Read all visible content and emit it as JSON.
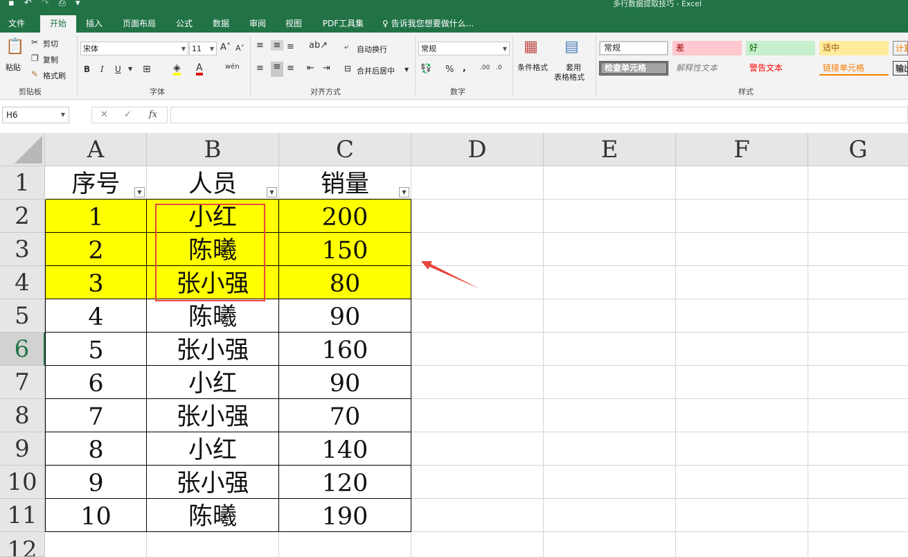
{
  "window": {
    "title": "多行数据提取技巧 - Excel"
  },
  "tabs": [
    {
      "label": "文件",
      "active": false
    },
    {
      "label": "开始",
      "active": true
    },
    {
      "label": "插入",
      "active": false
    },
    {
      "label": "页面布局",
      "active": false
    },
    {
      "label": "公式",
      "active": false
    },
    {
      "label": "数据",
      "active": false
    },
    {
      "label": "审阅",
      "active": false
    },
    {
      "label": "视图",
      "active": false
    },
    {
      "label": "PDF工具集",
      "active": false
    },
    {
      "label": "告诉我您想要做什么...",
      "active": false
    }
  ],
  "ribbon": {
    "clipboard": {
      "paste": "粘贴",
      "cut": "剪切",
      "copy": "复制",
      "format_painter": "格式刷",
      "group": "剪贴板"
    },
    "font": {
      "name": "宋体",
      "size": "11",
      "group": "字体",
      "bold": "B",
      "italic": "I",
      "underline": "U",
      "phonetic": "wén"
    },
    "alignment": {
      "wrap": "自动换行",
      "merge": "合并后居中",
      "group": "对齐方式"
    },
    "number": {
      "format": "常规",
      "group": "数字",
      "percent": "%",
      "comma": ","
    },
    "styles": {
      "conditional": "条件格式",
      "table_format_1": "套用",
      "table_format_2": "表格格式",
      "group": "样式",
      "cells": [
        {
          "label": "常规",
          "bg": "#ffffff",
          "color": "#000000"
        },
        {
          "label": "差",
          "bg": "#ffc7ce",
          "color": "#9c0006"
        },
        {
          "label": "好",
          "bg": "#c6efce",
          "color": "#006100"
        },
        {
          "label": "适中",
          "bg": "#ffeb9c",
          "color": "#9c5700"
        },
        {
          "label": "计算",
          "bg": "#f2f2f2",
          "color": "#fa7d00"
        },
        {
          "label": "检查单元格",
          "bg": "#a5a5a5",
          "color": "#ffffff"
        },
        {
          "label": "解释性文本",
          "bg": "#ffffff",
          "color": "#7f7f7f"
        },
        {
          "label": "警告文本",
          "bg": "#ffffff",
          "color": "#ff0000"
        },
        {
          "label": "链接单元格",
          "bg": "#ffffff",
          "color": "#fa7d00"
        },
        {
          "label": "输出",
          "bg": "#f2f2f2",
          "color": "#3f3f3f"
        }
      ]
    }
  },
  "formula_bar": {
    "name_box": "H6",
    "cancel": "✕",
    "enter": "✓",
    "fx": "fx",
    "value": ""
  },
  "sheet": {
    "columns": [
      "A",
      "B",
      "C",
      "D",
      "E",
      "F",
      "G"
    ],
    "rows": [
      "1",
      "2",
      "3",
      "4",
      "5",
      "6",
      "7",
      "8",
      "9",
      "10",
      "11",
      "12"
    ],
    "selected_row": "6",
    "header": [
      "序号",
      "人员",
      "销量"
    ],
    "data": [
      [
        "1",
        "小红",
        "200"
      ],
      [
        "2",
        "陈曦",
        "150"
      ],
      [
        "3",
        "张小强",
        "80"
      ],
      [
        "4",
        "陈曦",
        "90"
      ],
      [
        "5",
        "张小强",
        "160"
      ],
      [
        "6",
        "小红",
        "90"
      ],
      [
        "7",
        "张小强",
        "70"
      ],
      [
        "8",
        "小红",
        "140"
      ],
      [
        "9",
        "张小强",
        "120"
      ],
      [
        "10",
        "陈曦",
        "190"
      ]
    ],
    "highlight_color": "#ffff00",
    "highlighted_rows": [
      "2",
      "3",
      "4"
    ],
    "annotation_color": "#e8453c"
  }
}
